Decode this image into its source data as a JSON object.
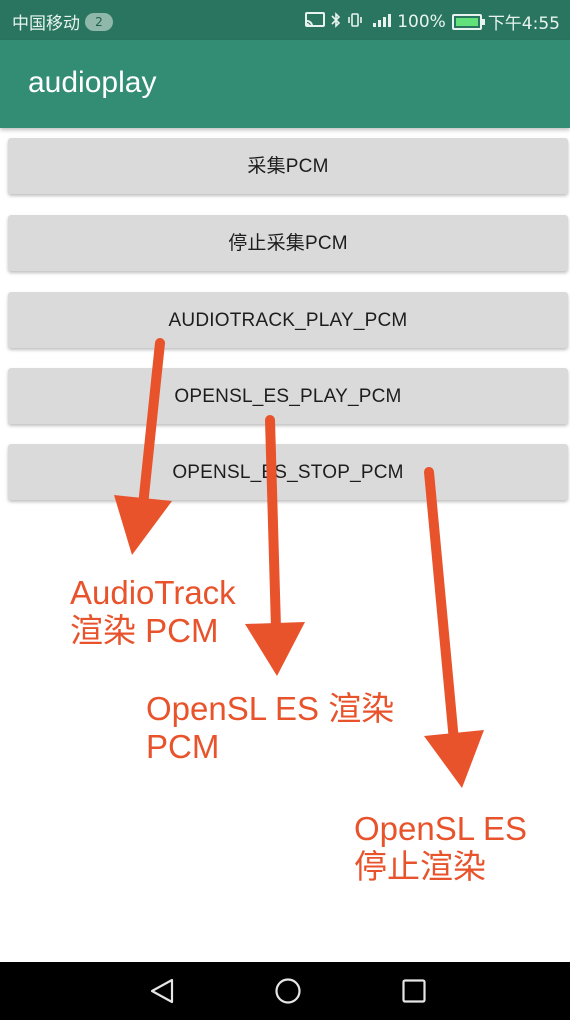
{
  "status_bar": {
    "carrier": "中国移动",
    "sim_badge": "2",
    "battery": "100%",
    "time": "下午4:55"
  },
  "app_bar": {
    "title": "audioplay"
  },
  "buttons": [
    {
      "label": "采集PCM"
    },
    {
      "label": "停止采集PCM"
    },
    {
      "label": "AUDIOTRACK_PLAY_PCM"
    },
    {
      "label": "OPENSL_ES_PLAY_PCM"
    },
    {
      "label": "OPENSL_ES_STOP_PCM"
    }
  ],
  "annotations": [
    {
      "line1": "AudioTrack",
      "line2": "渲染 PCM"
    },
    {
      "line1": "OpenSL ES 渲染",
      "line2": "PCM"
    },
    {
      "line1": "OpenSL ES",
      "line2": "停止渲染"
    }
  ],
  "colors": {
    "status_bar": "#2a7560",
    "app_bar": "#338d74",
    "button": "#dadada",
    "annotation": "#e8532c",
    "nav_bar": "#000000"
  },
  "icons": {
    "status": [
      "cast-icon",
      "bluetooth-icon",
      "vibrate-icon",
      "signal-icon",
      "battery-icon"
    ],
    "nav": [
      "back-icon",
      "home-icon",
      "recents-icon"
    ]
  }
}
